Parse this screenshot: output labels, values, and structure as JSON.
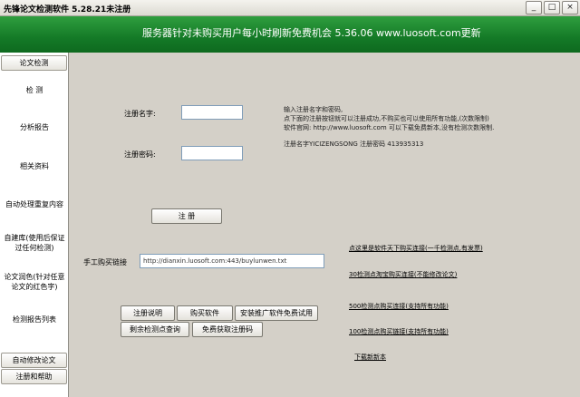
{
  "window": {
    "title": "先锋论文检测软件 5.28.21未注册",
    "minimize": "_",
    "maximize": "□",
    "close": "×"
  },
  "banner": {
    "text": "服务器针对未购买用户每小时刷新免费机会 5.36.06 www.luosoft.com更新"
  },
  "sidebar": {
    "top_tab": "论文检测",
    "items": [
      "检 测",
      "分析报告",
      "相关资料",
      "自动处理重复内容",
      "自建库(使用后保证过任何检测)",
      "论文润色(针对任意论文的红色字)",
      "检测报告列表"
    ],
    "bottom_tabs": [
      "自动修改论文",
      "注册和帮助"
    ]
  },
  "form": {
    "name_label": "注册名字:",
    "name_value": "",
    "code_label": "注册密码:",
    "code_value": "",
    "register_button": "注 册",
    "buy_link_label": "手工购买链接",
    "buy_link_value": "http://dianxin.luosoft.com:443/buylunwen.txt"
  },
  "info": {
    "line1": "输入注册名字和密码,",
    "line2": "点下面的注册按钮就可以注册成功,不购买也可以使用所有功能,(次数限制)",
    "line3": "软件官网: http://www.luosoft.com 可以下载免费新本,没有检测次数限制.",
    "line4": "注册名字YICIZENGSONG 注册密码 413935313"
  },
  "buttons": {
    "reg_help": "注册说明",
    "buy_software": "购买软件",
    "install_trial": "安装推广软件免费试用",
    "remaining_query": "剩余检测点查询",
    "free_code": "免费获取注册码"
  },
  "links": {
    "buy_tianxia": "点这里是软件天下购买连接(一千检测点,有发票)",
    "taobao_30": "30检测点淘宝购买连接(不能修改论文)",
    "buy_500": "500检测点购买连接(支持所有功能)",
    "buy_100": "100检测点购买链接(支持所有功能)",
    "download_new": "下载新新本"
  }
}
